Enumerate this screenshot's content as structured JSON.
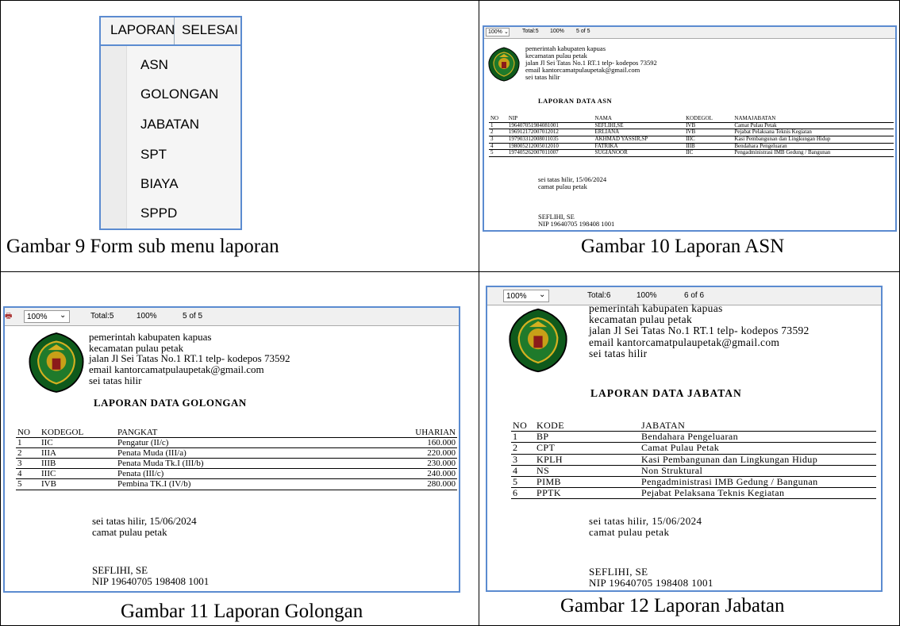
{
  "fig9": {
    "menu_bar": [
      "LAPORAN",
      "SELESAI"
    ],
    "menu_items": [
      "ASN",
      "GOLONGAN",
      "JABATAN",
      "SPT",
      "BIAYA",
      "SPPD"
    ],
    "caption": "Gambar 9 Form sub menu laporan"
  },
  "header": {
    "line1": "pemerintah kabupaten kapuas",
    "line2": "kecamatan pulau petak",
    "line3": "jalan Jl Sei Tatas No.1 RT.1 telp- kodepos 73592",
    "line4": "email kantorcamatpulaupetak@gmail.com",
    "line5": "sei tatas hilir"
  },
  "fig10": {
    "toolbar": {
      "zoom": "100%",
      "total": "Total:5",
      "pct": "100%",
      "page": "5 of 5"
    },
    "title": "LAPORAN DATA ASN",
    "columns": [
      "NO",
      "NIP",
      "NAMA",
      "KODEGOL",
      "NAMAJABATAN"
    ],
    "rows": [
      [
        "1",
        "196407051984081001",
        "SEFLIHI,SE",
        "IVB",
        "Camat Pulau Petak"
      ],
      [
        "2",
        "196912172007012012",
        "ERLIANA",
        "IVB",
        "Pejabat Pelaksana Teknis Kegiatan"
      ],
      [
        "3",
        "197903312008011035",
        "AKHMAD YASSIR,SP",
        "IIIC",
        "Kasi Pembangunan dan Lingkungan Hidup"
      ],
      [
        "4",
        "198005212005012010",
        "FATRIKA",
        "IIIB",
        "Bendahara Pengeluaran"
      ],
      [
        "5",
        "197405262007011007",
        "SUGIANOOR",
        "IIC",
        "Pengadministrasi IMB Gedung / Bangunan"
      ]
    ],
    "place_date": "sei tatas hilir, 15/06/2024",
    "position": "camat pulau petak",
    "signer": "SEFLIHI, SE",
    "nip": "NIP 19640705 198408 1001",
    "caption": "Gambar 10 Laporan ASN"
  },
  "fig11": {
    "toolbar": {
      "zoom": "100%",
      "total": "Total:5",
      "pct": "100%",
      "page": "5 of 5"
    },
    "title": "LAPORAN DATA GOLONGAN",
    "columns": [
      "NO",
      "KODEGOL",
      "PANGKAT",
      "UHARIAN"
    ],
    "rows": [
      [
        "1",
        "IIC",
        "Pengatur (II/c)",
        "160.000"
      ],
      [
        "2",
        "IIIA",
        "Penata Muda (III/a)",
        "220.000"
      ],
      [
        "3",
        "IIIB",
        "Penata Muda Tk.I (III/b)",
        "230.000"
      ],
      [
        "4",
        "IIIC",
        "Penata (III/c)",
        "240.000"
      ],
      [
        "5",
        "IVB",
        "Pembina TK.I (IV/b)",
        "280.000"
      ]
    ],
    "place_date": "sei tatas hilir, 15/06/2024",
    "position": "camat pulau petak",
    "signer": "SEFLIHI, SE",
    "nip": "NIP 19640705 198408 1001",
    "caption": "Gambar 11 Laporan Golongan"
  },
  "fig12": {
    "toolbar": {
      "zoom": "100%",
      "total": "Total:6",
      "pct": "100%",
      "page": "6 of 6"
    },
    "title": "LAPORAN DATA JABATAN",
    "columns": [
      "NO",
      "KODE",
      "JABATAN"
    ],
    "rows": [
      [
        "1",
        "BP",
        "Bendahara Pengeluaran"
      ],
      [
        "2",
        "CPT",
        "Camat Pulau Petak"
      ],
      [
        "3",
        "KPLH",
        "Kasi Pembangunan dan Lingkungan Hidup"
      ],
      [
        "4",
        "NS",
        "Non Struktural"
      ],
      [
        "5",
        "PIMB",
        "Pengadministrasi IMB Gedung / Bangunan"
      ],
      [
        "6",
        "PPTK",
        "Pejabat Pelaksana Teknis Kegiatan"
      ]
    ],
    "place_date": "sei tatas hilir, 15/06/2024",
    "position": "camat pulau petak",
    "signer": "SEFLIHI, SE",
    "nip": "NIP 19640705 198408 1001",
    "caption": "Gambar 12 Laporan Jabatan"
  }
}
